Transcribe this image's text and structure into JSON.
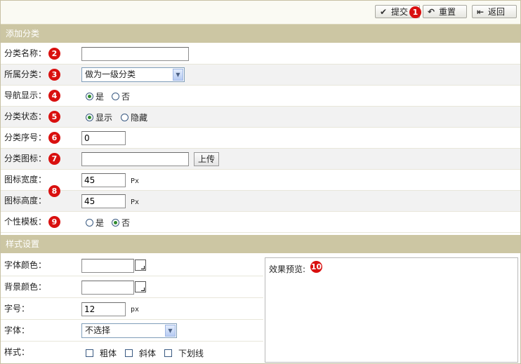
{
  "toolbar": {
    "submit_label": "提交",
    "reset_label": "重置",
    "back_label": "返回"
  },
  "section_add": {
    "title": "添加分类"
  },
  "section_style": {
    "title": "样式设置"
  },
  "badges": [
    "1",
    "2",
    "3",
    "4",
    "5",
    "6",
    "7",
    "8",
    "9",
    "10"
  ],
  "form": {
    "name": {
      "label": "分类名称：",
      "value": ""
    },
    "parent": {
      "label": "所属分类：",
      "selected": "做为一级分类"
    },
    "nav_show": {
      "label": "导航显示：",
      "options": [
        "是",
        "否"
      ],
      "selected": "是"
    },
    "status": {
      "label": "分类状态：",
      "options": [
        "显示",
        "隐藏"
      ],
      "selected": "显示"
    },
    "order": {
      "label": "分类序号：",
      "value": "0"
    },
    "icon": {
      "label": "分类图标：",
      "value": "",
      "upload_label": "上传"
    },
    "icon_width": {
      "label": "图标宽度：",
      "value": "45",
      "unit": "Px"
    },
    "icon_height": {
      "label": "图标高度：",
      "value": "45",
      "unit": "Px"
    },
    "custom_template": {
      "label": "个性模板：",
      "options": [
        "是",
        "否"
      ],
      "selected": "否"
    }
  },
  "style": {
    "font_color": {
      "label": "字体颜色：",
      "value": ""
    },
    "bg_color": {
      "label": "背景颜色：",
      "value": ""
    },
    "font_size": {
      "label": "字号：",
      "value": "12",
      "unit": "px"
    },
    "font_face": {
      "label": "字体：",
      "selected": "不选择"
    },
    "font_style": {
      "label": "样式：",
      "options": [
        "粗体",
        "斜体",
        "下划线"
      ]
    },
    "preview_label": "效果预览:"
  },
  "colors": {
    "header_bg": "#ccc6a3",
    "badge": "#d9100f",
    "alt_row": "#f2f2f2"
  }
}
